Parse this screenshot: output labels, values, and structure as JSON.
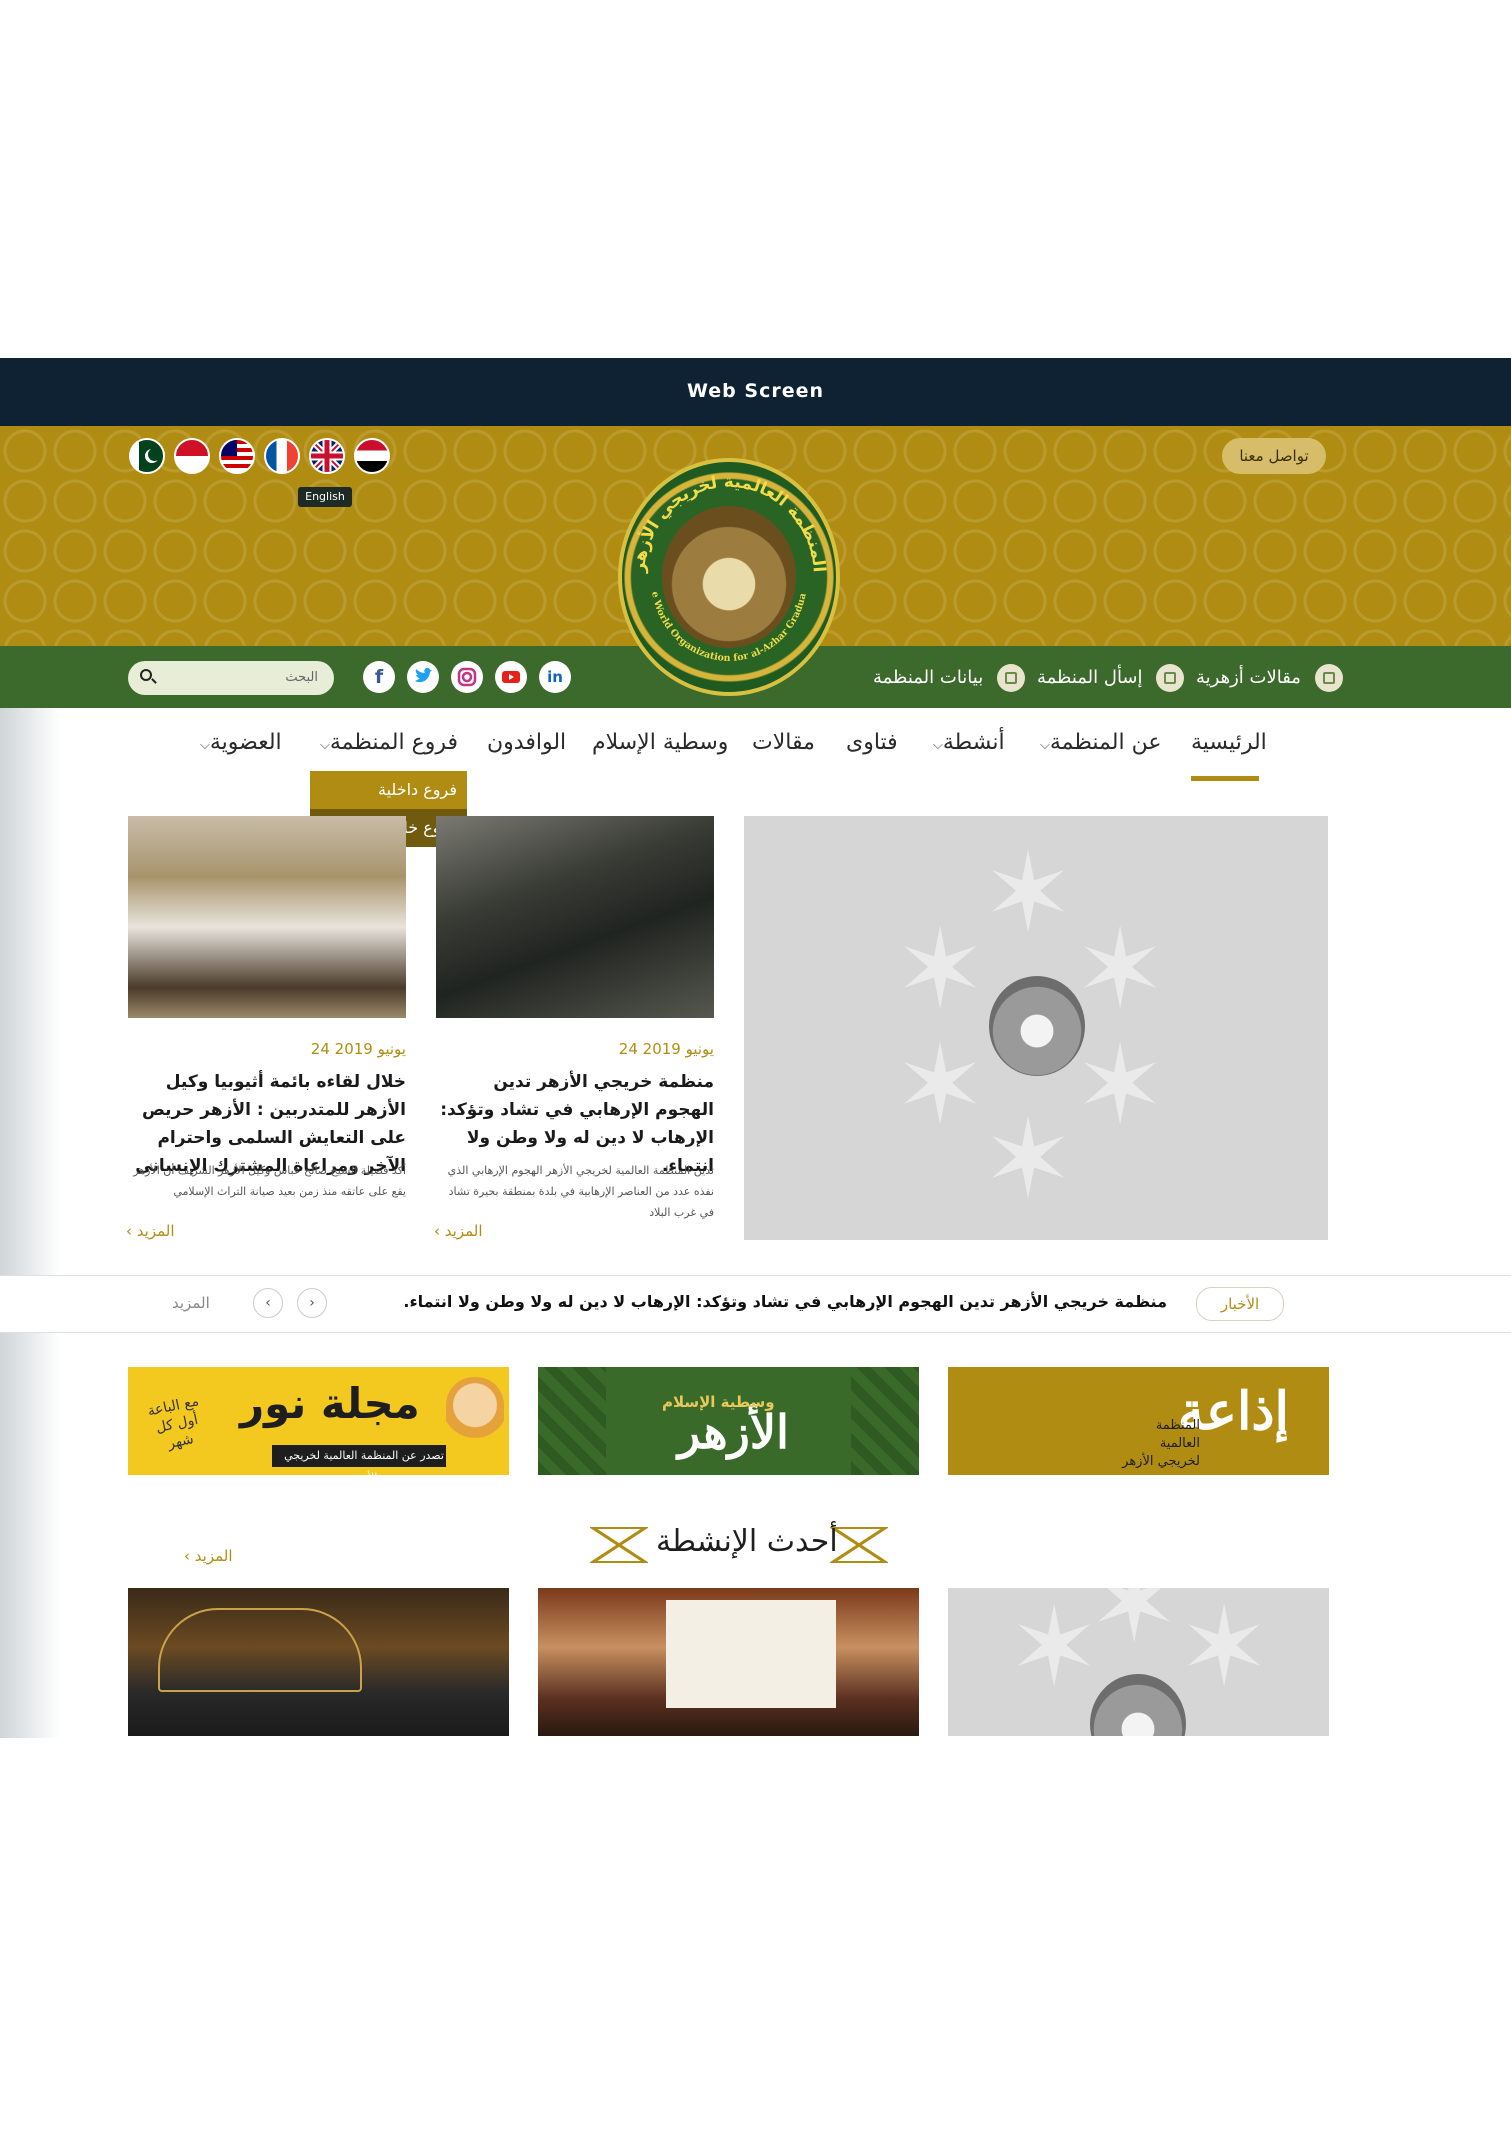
{
  "window": {
    "title": "Web Screen"
  },
  "header": {
    "contact_label": "تواصل معنا",
    "language_tooltip": "English",
    "languages": [
      "egypt-flag-icon",
      "uk-flag-icon",
      "france-flag-icon",
      "malaysia-flag-icon",
      "indonesia-flag-icon",
      "pakistan-flag-icon"
    ],
    "logo_text": "المنظمة العالمية لخريجي الأزهر",
    "logo_text_en": "The World Organization for al-Azhar Graduates"
  },
  "subnav": {
    "articles": "مقالات أزهرية",
    "message": "إسأل المنظمة",
    "statements": "بيانات المنظمة",
    "search_placeholder": "البحث",
    "social": [
      "linkedin-icon",
      "youtube-icon",
      "instagram-icon",
      "twitter-icon",
      "facebook-icon"
    ]
  },
  "nav": {
    "home": "الرئيسية",
    "about": "عن المنظمة",
    "activities": "أنشطة",
    "fatwas": "فتاوى",
    "articles": "مقالات",
    "wasatiya": "وسطية الإسلام",
    "wafidoun": "الوافدون",
    "branches": "فروع المنظمة",
    "membership": "العضوية",
    "branches_dropdown": [
      "فروع داخلية",
      "فروع خارجية"
    ]
  },
  "news": [
    {
      "date": "24 يونيو 2019",
      "title": "منظمة خريجي الأزهر تدين الهجوم الإرهابي في تشاد وتؤكد: الإرهاب لا دين له ولا وطن ولا انتماء.",
      "excerpt": "تدين المنظمة العالمية لخريجي الأزهر الهجوم الإرهابي الذي نفذه عدد من العناصر الإرهابية في بلدة بمنطقة بحيرة تشاد في غرب البلاد",
      "more": "المزيد"
    },
    {
      "date": "24 يونيو 2019",
      "title": "خلال لقاءه بائمة أثيوبيا وكيل الأزهر للمتدربين : الأزهر حريص على التعايش السلمى واحترام الآخر ومراعاة المشترك الإنسانى",
      "excerpt": "أكد فضيلة الشيخ صالح عباس وكيل الأزهر الشريف أن الأزهر يقع على عاتقه منذ زمن بعيد صيانة التراث الإسلامي",
      "more": "المزيد"
    }
  ],
  "ticker": {
    "label": "الأخبار",
    "text": "منظمة خريجي الأزهر تدين الهجوم الإرهابي في تشاد وتؤكد: الإرهاب لا دين له ولا وطن ولا انتماء.",
    "more": "المزيد"
  },
  "banners": {
    "radio_title": "إذاعة",
    "radio_sub": "المنظمة العالمية لخريجي الأزهر",
    "wasat_title": "الأزهر",
    "wasat_sub": "وسطية الإسلام",
    "noor_title": "مجلة نور",
    "noor_side": "مع الباعة أول كل شهر",
    "noor_strip": "تصدر عن المنظمة العالمية لخريجي الأزهر"
  },
  "activities": {
    "title": "أحدث الإنشطة",
    "more": "المزيد"
  },
  "colors": {
    "gold": "#b08d12",
    "green": "#3c6a2c",
    "navy": "#0e2233"
  }
}
